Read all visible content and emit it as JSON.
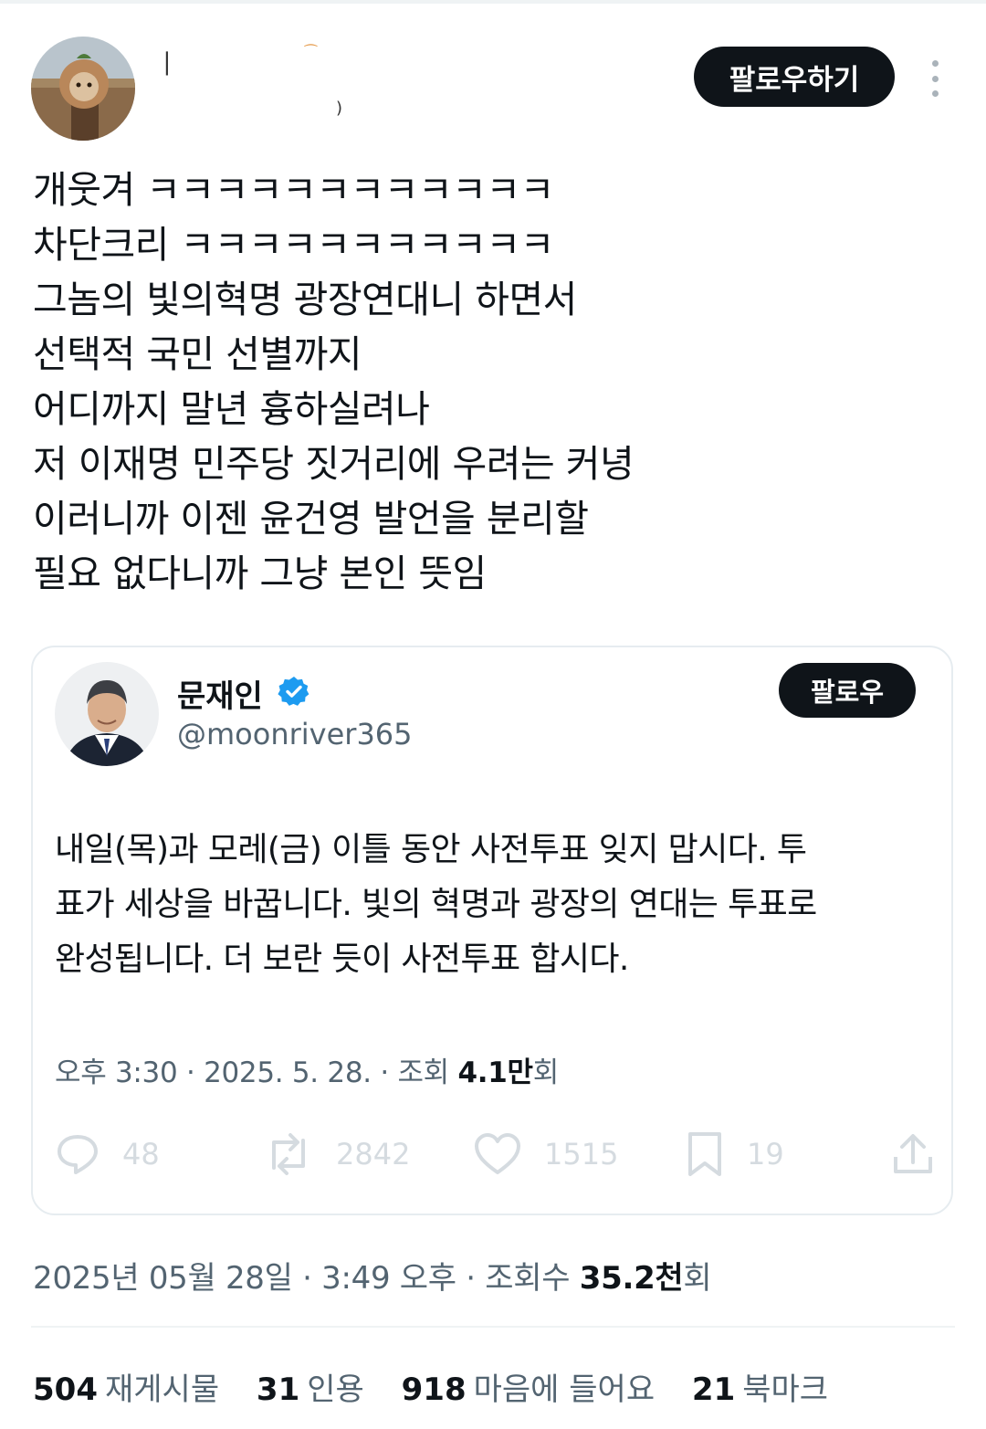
{
  "post": {
    "follow_label": "팔로우하기",
    "lines": [
      "개웃겨 ㅋㅋㅋㅋㅋㅋㅋㅋㅋㅋㅋㅋ",
      "차단크리 ㅋㅋㅋㅋㅋㅋㅋㅋㅋㅋㅋ",
      "그놈의 빛의혁명 광장연대니 하면서",
      "선택적 국민 선별까지",
      "어디까지 말년 흉하실려나",
      "저 이재명 민주당 짓거리에 우려는 커녕",
      "이러니까 이젠 윤건영 발언을 분리할",
      "필요 없다니까 그냥 본인 뜻임"
    ],
    "meta_prefix": "2025년 05월 28일 · 3:49 오후 · 조회수 ",
    "views_number": "35.2천",
    "views_suffix": "회",
    "stats": {
      "reposts_count": "504",
      "reposts_label": "재게시물",
      "quotes_count": "31",
      "quotes_label": "인용",
      "likes_count": "918",
      "likes_label": "마음에 들어요",
      "bookmarks_count": "21",
      "bookmarks_label": "북마크"
    }
  },
  "quote": {
    "author_name": "문재인",
    "handle": "@moonriver365",
    "follow_label": "팔로우",
    "text_lines": [
      "내일(목)과 모레(금) 이틀 동안 사전투표 잊지 맙시다. 투",
      "표가 세상을 바꿉니다. 빛의 혁명과 광장의 연대는 투표로",
      "완성됩니다. 더 보란 듯이 사전투표 합시다."
    ],
    "meta_prefix": "오후 3:30 · 2025. 5. 28. · 조회 ",
    "views_number": "4.1만",
    "views_suffix": "회",
    "actions": {
      "reply_count": "48",
      "repost_count": "2842",
      "like_count": "1515",
      "bookmark_count": "19"
    }
  },
  "colors": {
    "verified": "#1d9bf0",
    "button_bg": "#0f1419",
    "muted_text": "#536471",
    "faded_action": "#d5dbe0"
  }
}
